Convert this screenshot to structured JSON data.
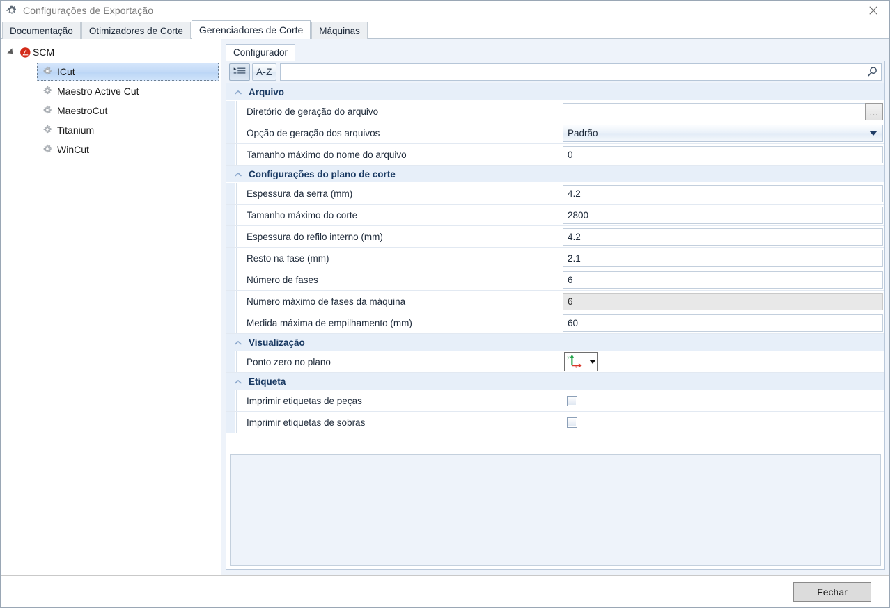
{
  "window": {
    "title": "Configurações de Exportação",
    "title_icon": "gear-icon",
    "close_label": "✕"
  },
  "tabs": [
    {
      "label": "Documentação",
      "active": false
    },
    {
      "label": "Otimizadores de Corte",
      "active": false
    },
    {
      "label": "Gerenciadores de Corte",
      "active": true
    },
    {
      "label": "Máquinas",
      "active": false
    }
  ],
  "tree": {
    "root": {
      "label": "SCM",
      "icon": "scm-logo-icon",
      "expander": "expanded-triangle-icon"
    },
    "items": [
      {
        "label": "ICut",
        "icon": "gear-icon",
        "selected": true
      },
      {
        "label": "Maestro Active Cut",
        "icon": "gear-icon",
        "selected": false
      },
      {
        "label": "MaestroCut",
        "icon": "gear-icon",
        "selected": false
      },
      {
        "label": "Titanium",
        "icon": "gear-icon",
        "selected": false
      },
      {
        "label": "WinCut",
        "icon": "gear-icon",
        "selected": false
      }
    ]
  },
  "inner_tabs": [
    {
      "label": "Configurador",
      "active": true
    }
  ],
  "toolbar": {
    "categorized_icon": "categorized-list-icon",
    "sort_label": "A-Z",
    "search_value": "",
    "search_placeholder": "",
    "search_icon": "search-icon"
  },
  "property_grid": {
    "categories": [
      {
        "label": "Arquivo",
        "chevron": "chevron-up-icon",
        "rows": [
          {
            "name": "Diretório de geração do arquivo",
            "value": "",
            "type": "text-browse",
            "browse_label": "...",
            "disabled": false
          },
          {
            "name": "Opção de geração dos arquivos",
            "value": "Padrão",
            "type": "combo",
            "disabled": false
          },
          {
            "name": "Tamanho máximo do nome do arquivo",
            "value": "0",
            "type": "text",
            "disabled": false
          }
        ]
      },
      {
        "label": "Configurações do plano de corte",
        "chevron": "chevron-up-icon",
        "rows": [
          {
            "name": "Espessura da serra (mm)",
            "value": "4.2",
            "type": "text",
            "disabled": false
          },
          {
            "name": "Tamanho máximo do corte",
            "value": "2800",
            "type": "text",
            "disabled": false
          },
          {
            "name": "Espessura do refilo interno (mm)",
            "value": "4.2",
            "type": "text",
            "disabled": false
          },
          {
            "name": "Resto na fase (mm)",
            "value": "2.1",
            "type": "text",
            "disabled": false
          },
          {
            "name": "Número de fases",
            "value": "6",
            "type": "text",
            "disabled": false
          },
          {
            "name": "Número máximo de fases da máquina",
            "value": "6",
            "type": "text",
            "disabled": true
          },
          {
            "name": "Medida máxima de empilhamento (mm)",
            "value": "60",
            "type": "text",
            "disabled": false
          }
        ]
      },
      {
        "label": "Visualização",
        "chevron": "chevron-up-icon",
        "rows": [
          {
            "name": "Ponto zero no plano",
            "value": "",
            "type": "zero-point",
            "icon": "axis-origin-icon",
            "disabled": false
          }
        ]
      },
      {
        "label": "Etiqueta",
        "chevron": "chevron-up-icon",
        "rows": [
          {
            "name": "Imprimir etiquetas de peças",
            "value": "",
            "type": "checkbox",
            "checked": false,
            "disabled": false
          },
          {
            "name": "Imprimir etiquetas de sobras",
            "value": "",
            "type": "checkbox",
            "checked": false,
            "disabled": false
          }
        ]
      }
    ]
  },
  "footer": {
    "close_button": "Fechar"
  },
  "colors": {
    "category_bg": "#e7eff9",
    "category_text": "#1a3a63",
    "selection_blue": "#c2daf7",
    "pane_bg": "#eef3fa",
    "accent_red": "#d32a18",
    "axis_y_green": "#22a34a",
    "axis_x_red": "#d8392b"
  }
}
